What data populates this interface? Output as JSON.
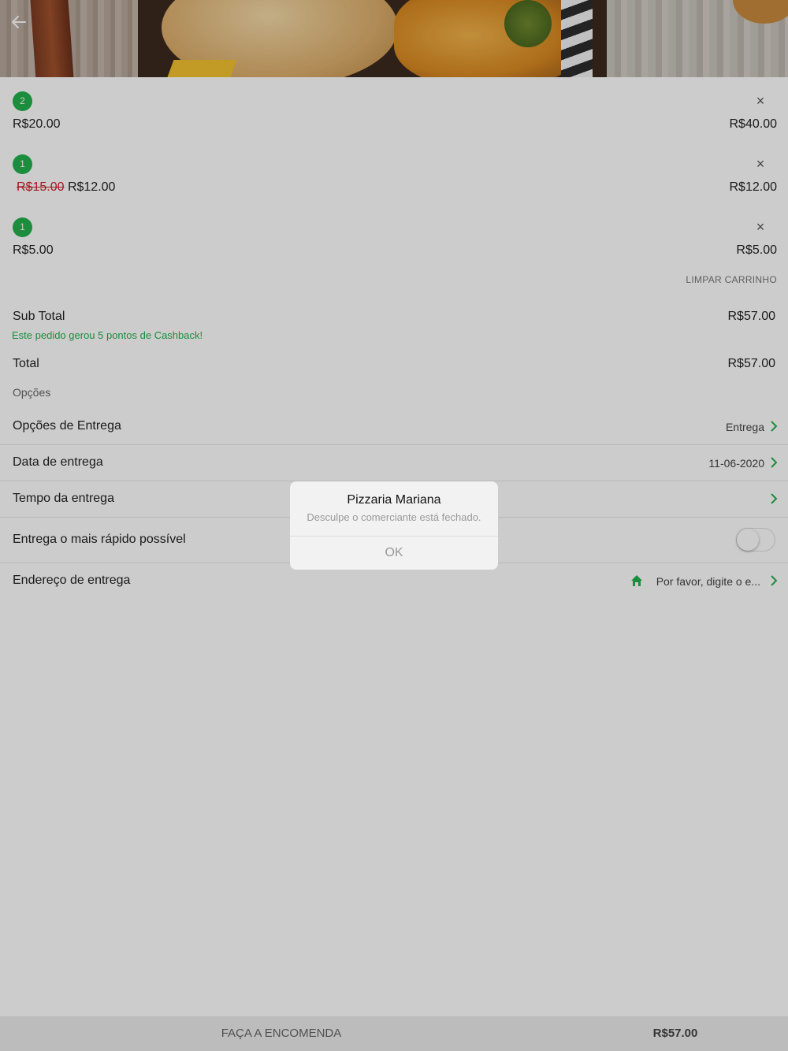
{
  "cart": {
    "items": [
      {
        "qty": "2",
        "unit_price": "R$20.00",
        "old_price": "",
        "line_total": "R$40.00"
      },
      {
        "qty": "1",
        "unit_price": "R$12.00",
        "old_price": "R$15.00",
        "line_total": "R$12.00"
      },
      {
        "qty": "1",
        "unit_price": "R$5.00",
        "old_price": "",
        "line_total": "R$5.00"
      }
    ],
    "remove_symbol": "×",
    "clear_label": "LIMPAR CARRINHO"
  },
  "summary": {
    "subtotal_label": "Sub Total",
    "subtotal_value": "R$57.00",
    "cashback_note": "Este pedido gerou 5 pontos de Cashback!",
    "total_label": "Total",
    "total_value": "R$57.00"
  },
  "options": {
    "section_title": "Opções",
    "delivery_options_label": "Opções de Entrega",
    "delivery_options_value": "Entrega",
    "delivery_date_label": "Data de entrega",
    "delivery_date_value": "11-06-2020",
    "delivery_time_label": "Tempo da entrega",
    "asap_label": "Entrega o mais rápido possível",
    "asap_enabled": false,
    "address_label": "Endereço de entrega",
    "address_value": "Por favor, digite o e..."
  },
  "footer": {
    "order_label": "FAÇA A ENCOMENDA",
    "total_value": "R$57.00"
  },
  "dialog": {
    "title": "Pizzaria Mariana",
    "message": "Desculpe o comerciante está fechado.",
    "ok_label": "OK"
  },
  "colors": {
    "accent_green": "#22b14c",
    "strike_red": "#d0202a"
  },
  "icons": {
    "back": "arrow-left-icon",
    "chevron": "chevron-right-icon",
    "home": "home-icon",
    "close": "close-icon"
  }
}
